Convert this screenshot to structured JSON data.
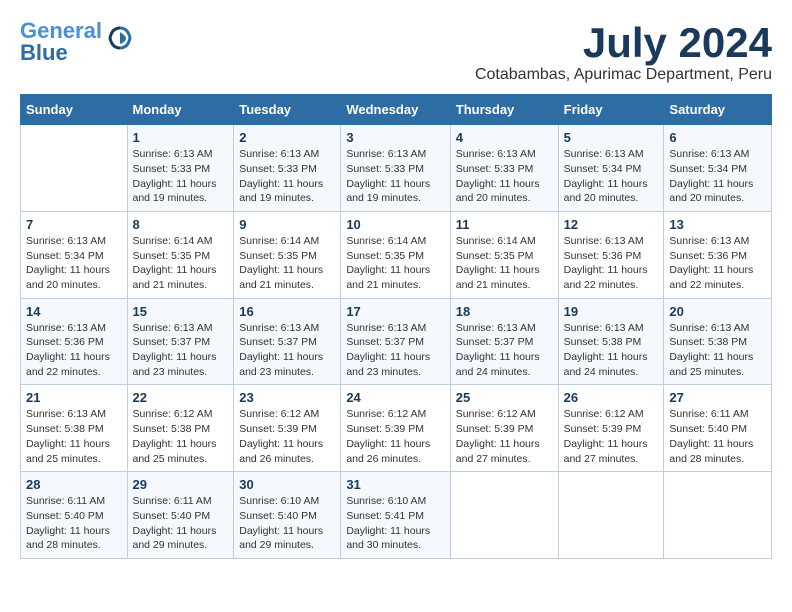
{
  "header": {
    "logo_general": "General",
    "logo_blue": "Blue",
    "month_year": "July 2024",
    "location": "Cotabambas, Apurimac Department, Peru"
  },
  "days_of_week": [
    "Sunday",
    "Monday",
    "Tuesday",
    "Wednesday",
    "Thursday",
    "Friday",
    "Saturday"
  ],
  "weeks": [
    [
      {
        "day": "",
        "info": ""
      },
      {
        "day": "1",
        "info": "Sunrise: 6:13 AM\nSunset: 5:33 PM\nDaylight: 11 hours\nand 19 minutes."
      },
      {
        "day": "2",
        "info": "Sunrise: 6:13 AM\nSunset: 5:33 PM\nDaylight: 11 hours\nand 19 minutes."
      },
      {
        "day": "3",
        "info": "Sunrise: 6:13 AM\nSunset: 5:33 PM\nDaylight: 11 hours\nand 19 minutes."
      },
      {
        "day": "4",
        "info": "Sunrise: 6:13 AM\nSunset: 5:33 PM\nDaylight: 11 hours\nand 20 minutes."
      },
      {
        "day": "5",
        "info": "Sunrise: 6:13 AM\nSunset: 5:34 PM\nDaylight: 11 hours\nand 20 minutes."
      },
      {
        "day": "6",
        "info": "Sunrise: 6:13 AM\nSunset: 5:34 PM\nDaylight: 11 hours\nand 20 minutes."
      }
    ],
    [
      {
        "day": "7",
        "info": "Sunrise: 6:13 AM\nSunset: 5:34 PM\nDaylight: 11 hours\nand 20 minutes."
      },
      {
        "day": "8",
        "info": "Sunrise: 6:14 AM\nSunset: 5:35 PM\nDaylight: 11 hours\nand 21 minutes."
      },
      {
        "day": "9",
        "info": "Sunrise: 6:14 AM\nSunset: 5:35 PM\nDaylight: 11 hours\nand 21 minutes."
      },
      {
        "day": "10",
        "info": "Sunrise: 6:14 AM\nSunset: 5:35 PM\nDaylight: 11 hours\nand 21 minutes."
      },
      {
        "day": "11",
        "info": "Sunrise: 6:14 AM\nSunset: 5:35 PM\nDaylight: 11 hours\nand 21 minutes."
      },
      {
        "day": "12",
        "info": "Sunrise: 6:13 AM\nSunset: 5:36 PM\nDaylight: 11 hours\nand 22 minutes."
      },
      {
        "day": "13",
        "info": "Sunrise: 6:13 AM\nSunset: 5:36 PM\nDaylight: 11 hours\nand 22 minutes."
      }
    ],
    [
      {
        "day": "14",
        "info": "Sunrise: 6:13 AM\nSunset: 5:36 PM\nDaylight: 11 hours\nand 22 minutes."
      },
      {
        "day": "15",
        "info": "Sunrise: 6:13 AM\nSunset: 5:37 PM\nDaylight: 11 hours\nand 23 minutes."
      },
      {
        "day": "16",
        "info": "Sunrise: 6:13 AM\nSunset: 5:37 PM\nDaylight: 11 hours\nand 23 minutes."
      },
      {
        "day": "17",
        "info": "Sunrise: 6:13 AM\nSunset: 5:37 PM\nDaylight: 11 hours\nand 23 minutes."
      },
      {
        "day": "18",
        "info": "Sunrise: 6:13 AM\nSunset: 5:37 PM\nDaylight: 11 hours\nand 24 minutes."
      },
      {
        "day": "19",
        "info": "Sunrise: 6:13 AM\nSunset: 5:38 PM\nDaylight: 11 hours\nand 24 minutes."
      },
      {
        "day": "20",
        "info": "Sunrise: 6:13 AM\nSunset: 5:38 PM\nDaylight: 11 hours\nand 25 minutes."
      }
    ],
    [
      {
        "day": "21",
        "info": "Sunrise: 6:13 AM\nSunset: 5:38 PM\nDaylight: 11 hours\nand 25 minutes."
      },
      {
        "day": "22",
        "info": "Sunrise: 6:12 AM\nSunset: 5:38 PM\nDaylight: 11 hours\nand 25 minutes."
      },
      {
        "day": "23",
        "info": "Sunrise: 6:12 AM\nSunset: 5:39 PM\nDaylight: 11 hours\nand 26 minutes."
      },
      {
        "day": "24",
        "info": "Sunrise: 6:12 AM\nSunset: 5:39 PM\nDaylight: 11 hours\nand 26 minutes."
      },
      {
        "day": "25",
        "info": "Sunrise: 6:12 AM\nSunset: 5:39 PM\nDaylight: 11 hours\nand 27 minutes."
      },
      {
        "day": "26",
        "info": "Sunrise: 6:12 AM\nSunset: 5:39 PM\nDaylight: 11 hours\nand 27 minutes."
      },
      {
        "day": "27",
        "info": "Sunrise: 6:11 AM\nSunset: 5:40 PM\nDaylight: 11 hours\nand 28 minutes."
      }
    ],
    [
      {
        "day": "28",
        "info": "Sunrise: 6:11 AM\nSunset: 5:40 PM\nDaylight: 11 hours\nand 28 minutes."
      },
      {
        "day": "29",
        "info": "Sunrise: 6:11 AM\nSunset: 5:40 PM\nDaylight: 11 hours\nand 29 minutes."
      },
      {
        "day": "30",
        "info": "Sunrise: 6:10 AM\nSunset: 5:40 PM\nDaylight: 11 hours\nand 29 minutes."
      },
      {
        "day": "31",
        "info": "Sunrise: 6:10 AM\nSunset: 5:41 PM\nDaylight: 11 hours\nand 30 minutes."
      },
      {
        "day": "",
        "info": ""
      },
      {
        "day": "",
        "info": ""
      },
      {
        "day": "",
        "info": ""
      }
    ]
  ]
}
